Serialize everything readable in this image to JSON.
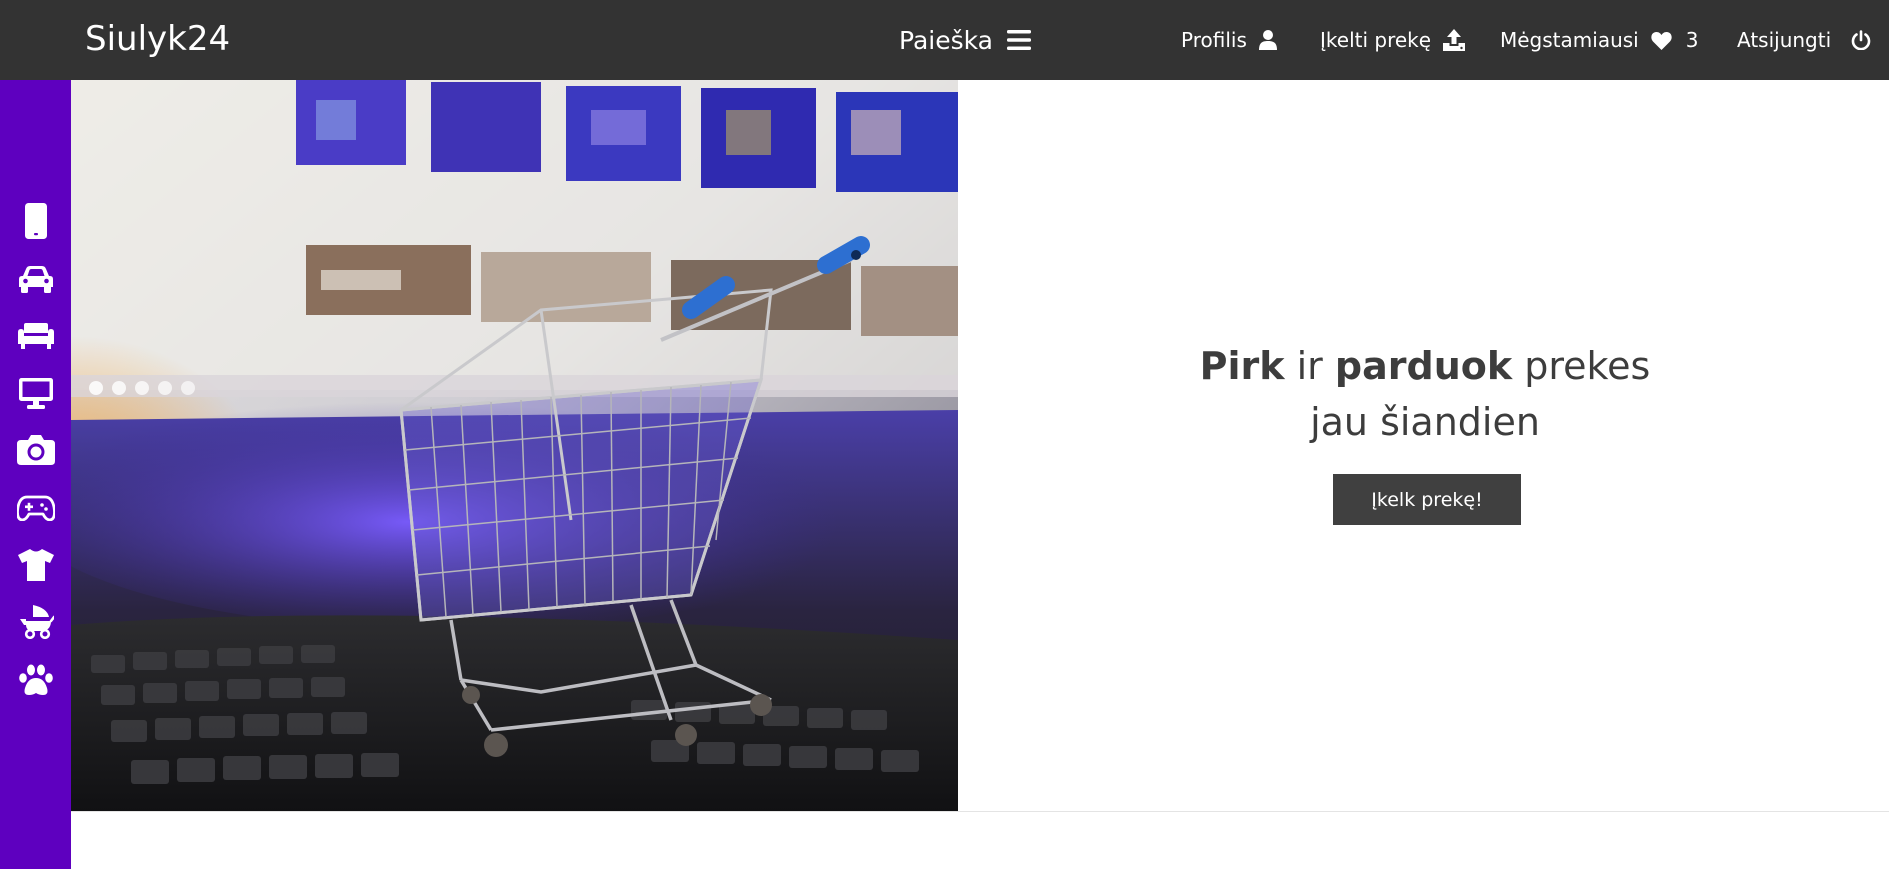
{
  "navbar": {
    "brand": "Siulyk24",
    "search_label": "Paieška",
    "search_icon": "hamburger-menu-icon",
    "links": {
      "profile": {
        "label": "Profilis",
        "icon": "user-icon"
      },
      "upload": {
        "label": "Įkelti prekę",
        "icon": "upload-icon"
      },
      "favorites": {
        "label": "Mėgstamiausi",
        "icon": "heart-icon",
        "count": "3"
      },
      "logout": {
        "label": "Atsijungti",
        "icon": "power-icon"
      }
    }
  },
  "sidebar": {
    "categories": [
      {
        "icon": "mobile-phone-icon"
      },
      {
        "icon": "car-icon"
      },
      {
        "icon": "couch-icon"
      },
      {
        "icon": "desktop-monitor-icon"
      },
      {
        "icon": "camera-icon"
      },
      {
        "icon": "gamepad-icon"
      },
      {
        "icon": "tshirt-icon"
      },
      {
        "icon": "baby-carriage-icon"
      },
      {
        "icon": "paw-icon"
      }
    ]
  },
  "hero": {
    "headline_word_1": "Pirk",
    "headline_word_2": "ir",
    "headline_word_3": "parduok",
    "headline_word_4": "prekes",
    "headline_line_2": "jau šiandien",
    "cta_label": "Įkelk prekę!"
  },
  "colors": {
    "navbar_bg": "#333333",
    "sidebar_bg": "#5e00bf",
    "cta_bg": "#404040",
    "headline_text": "#3d3d3d"
  }
}
